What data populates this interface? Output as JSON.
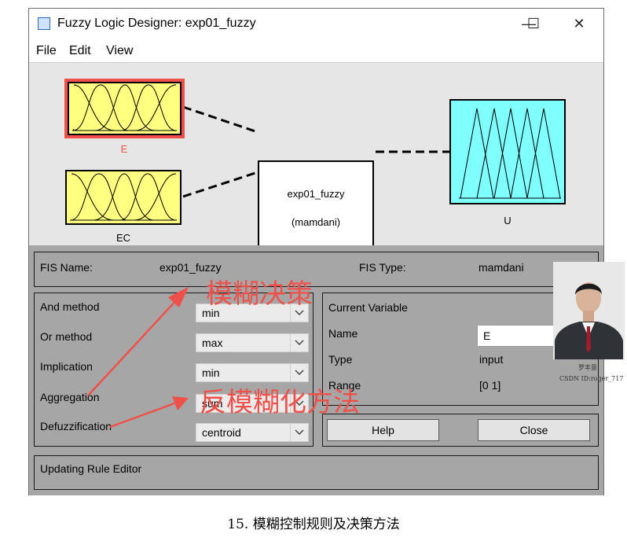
{
  "window": {
    "title": "Fuzzy Logic Designer: exp01_fuzzy",
    "controls": [
      "—",
      "☐",
      "✕"
    ]
  },
  "menu": [
    "File",
    "Edit",
    "View"
  ],
  "diagram": {
    "inputs": [
      "E",
      "EC"
    ],
    "output": "U",
    "fis_name": "exp01_fuzzy",
    "fis_method": "(mamdani)"
  },
  "info": {
    "fis_name_label": "FIS Name:",
    "fis_name_value": "exp01_fuzzy",
    "fis_type_label": "FIS Type:",
    "fis_type_value": "mamdani"
  },
  "methods": [
    {
      "label": "And method",
      "value": "min"
    },
    {
      "label": "Or method",
      "value": "max"
    },
    {
      "label": "Implication",
      "value": "min"
    },
    {
      "label": "Aggregation",
      "value": "sum"
    },
    {
      "label": "Defuzzification",
      "value": "centroid"
    }
  ],
  "current_variable": {
    "heading": "Current Variable",
    "name_label": "Name",
    "name_value": "E",
    "type_label": "Type",
    "type_value": "input",
    "range_label": "Range",
    "range_value": "[0 1]"
  },
  "buttons": {
    "help": "Help",
    "close": "Close"
  },
  "status": "Updating Rule Editor",
  "annotations": {
    "top": "模糊决策",
    "bottom": "反模糊化方法"
  },
  "watermark": {
    "name": "罗丰意",
    "id": "CSDN ID:roger_717"
  },
  "caption": "15.  模糊控制规则及决策方法",
  "colors": {
    "input_mf": "#ffff80",
    "output_mf": "#80ffff",
    "selected": "#f0504a",
    "annotation": "#f0504a",
    "panel": "#a6a6a6"
  }
}
